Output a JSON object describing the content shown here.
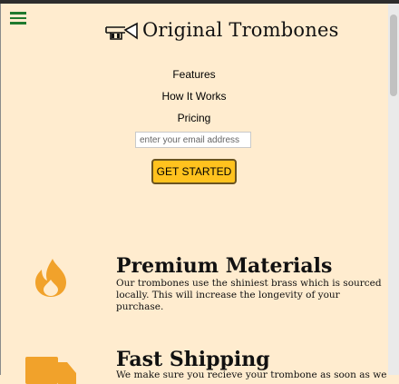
{
  "brand": {
    "name": "Original Trombones",
    "logo_icon": "trombone-logo-icon"
  },
  "menu": {
    "icon": "hamburger-menu-icon"
  },
  "nav": {
    "items": [
      "Features",
      "How It Works",
      "Pricing"
    ]
  },
  "signup": {
    "email_placeholder": "enter your email address",
    "button_label": "GET STARTED"
  },
  "features": [
    {
      "icon": "fire-icon",
      "title": "Premium Materials",
      "description": "Our trombones use the shiniest brass which is sourced locally. This will increase the longevity of your purchase."
    },
    {
      "icon": "truck-icon",
      "title": "Fast Shipping",
      "description": "We make sure you recieve your trombone as soon as we"
    }
  ],
  "colors": {
    "background": "#ffeccf",
    "accent": "#ffc21e",
    "icon_orange": "#f1a22b",
    "menu_green": "#1f7a2e"
  }
}
